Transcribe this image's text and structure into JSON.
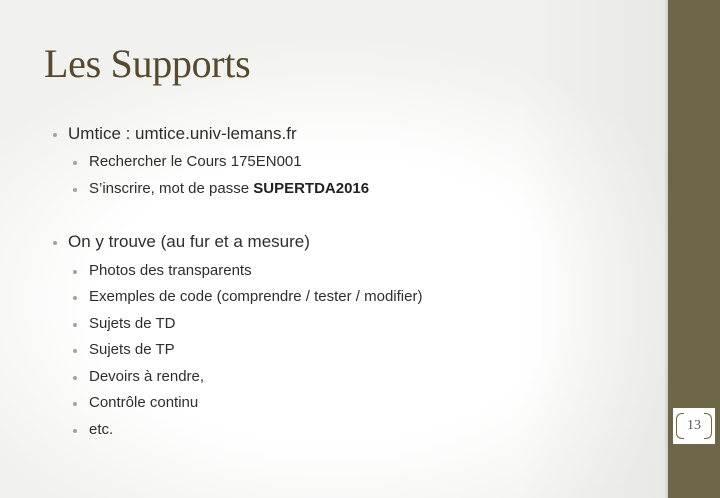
{
  "slide": {
    "title": "Les Supports",
    "page_number": "13",
    "sections": [
      {
        "text": "Umtice : umtice.univ-lemans.fr",
        "items": [
          {
            "text": "Rechercher le Cours 175EN001"
          },
          {
            "text": "S’inscrire, mot de passe ",
            "bold": "SUPERTDA2016"
          }
        ]
      },
      {
        "text": "On y trouve (au fur et a mesure)",
        "items": [
          {
            "text": "Photos des transparents"
          },
          {
            "text": "Exemples de code (comprendre / tester / modifier)"
          },
          {
            "text": "Sujets de TD"
          },
          {
            "text": "Sujets de TP"
          },
          {
            "text": "Devoirs à rendre,"
          },
          {
            "text": "Contrôle continu"
          },
          {
            "text": "etc."
          }
        ]
      }
    ]
  },
  "colors": {
    "title": "#56492d",
    "sidebar": "#6e6647",
    "bullet": "#9aa7a0",
    "body_text": "#2e2e2e"
  }
}
